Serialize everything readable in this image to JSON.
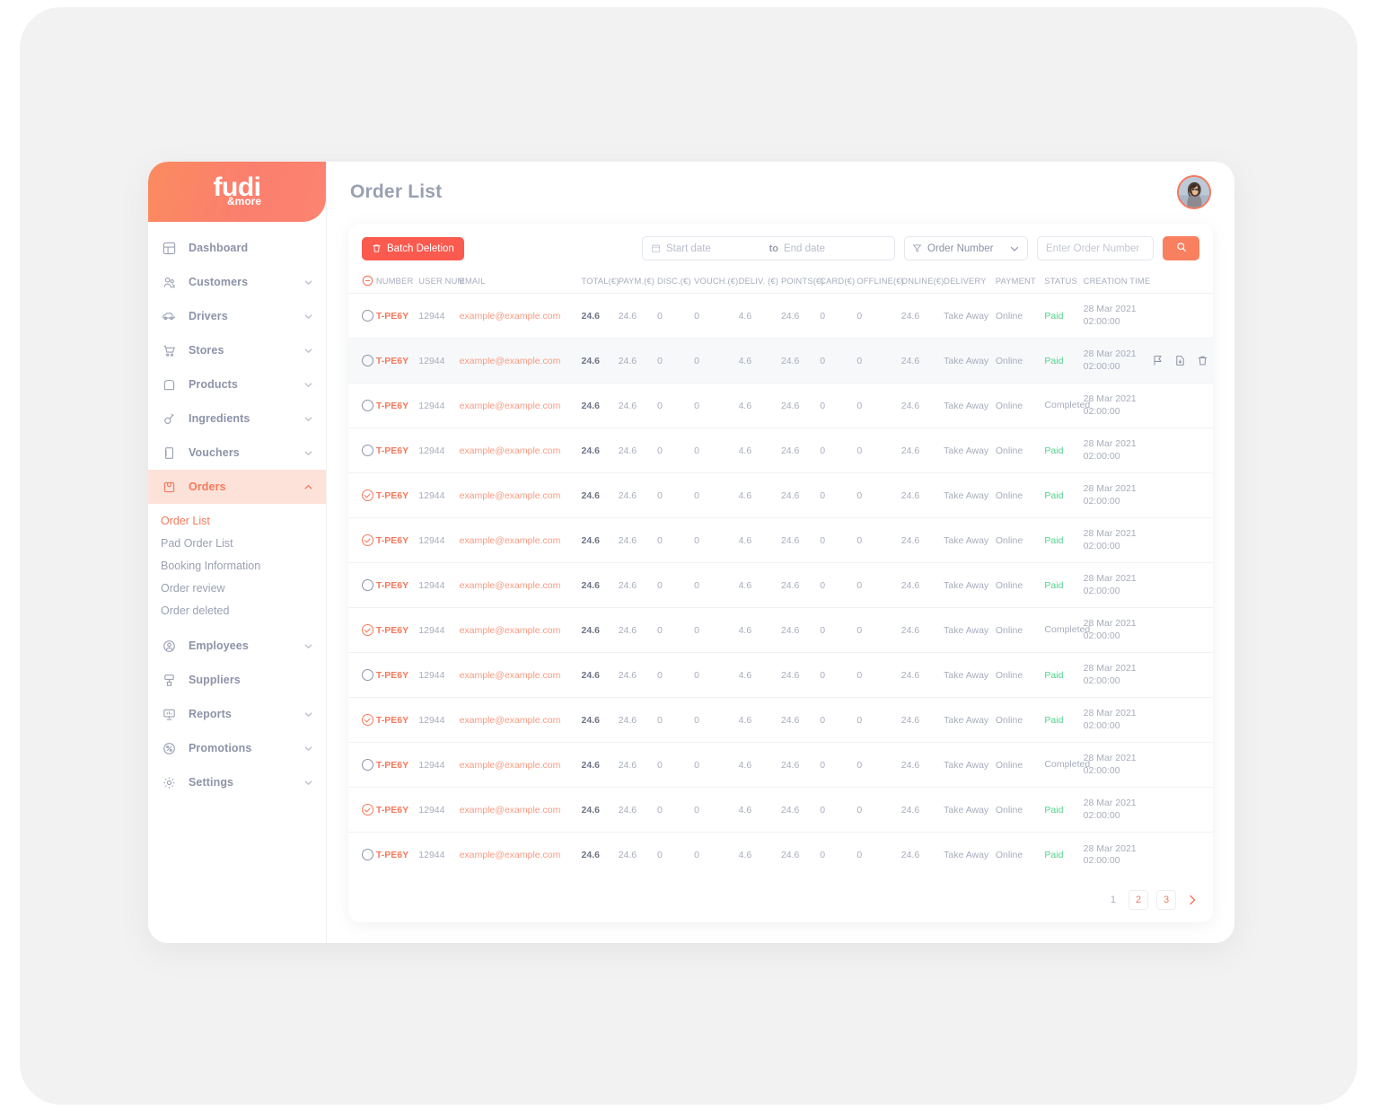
{
  "brand": {
    "line1": "fudi",
    "line2": "&more"
  },
  "header": {
    "title": "Order List"
  },
  "sidebar": {
    "items": [
      {
        "label": "Dashboard",
        "icon": "dashboard-icon",
        "expandable": false
      },
      {
        "label": "Customers",
        "icon": "customers-icon",
        "expandable": true
      },
      {
        "label": "Drivers",
        "icon": "drivers-icon",
        "expandable": true
      },
      {
        "label": "Stores",
        "icon": "stores-icon",
        "expandable": true
      },
      {
        "label": "Products",
        "icon": "products-icon",
        "expandable": true
      },
      {
        "label": "Ingredients",
        "icon": "ingredients-icon",
        "expandable": true
      },
      {
        "label": "Vouchers",
        "icon": "vouchers-icon",
        "expandable": true
      },
      {
        "label": "Orders",
        "icon": "orders-icon",
        "expandable": true,
        "active": true
      },
      {
        "label": "Employees",
        "icon": "employees-icon",
        "expandable": true
      },
      {
        "label": "Suppliers",
        "icon": "suppliers-icon",
        "expandable": false
      },
      {
        "label": "Reports",
        "icon": "reports-icon",
        "expandable": true
      },
      {
        "label": "Promotions",
        "icon": "promotions-icon",
        "expandable": true
      },
      {
        "label": "Settings",
        "icon": "settings-icon",
        "expandable": true
      }
    ],
    "submenu": [
      {
        "label": "Order List",
        "active": true
      },
      {
        "label": "Pad Order List",
        "active": false
      },
      {
        "label": "Booking Information",
        "active": false
      },
      {
        "label": "Order review",
        "active": false
      },
      {
        "label": "Order deleted",
        "active": false
      }
    ]
  },
  "toolbar": {
    "batch_delete_label": "Batch Deletion",
    "start_date_placeholder": "Start date",
    "date_separator": "to",
    "end_date_placeholder": "End date",
    "filter_selected": "Order Number",
    "search_placeholder": "Enter Order Number",
    "search_value": ""
  },
  "table": {
    "columns": [
      "NUMBER",
      "USER NUM",
      "EMAIL",
      "TOTAL(€)",
      "PAYM.(€)",
      "DISC.(€)",
      "VOUCH.(€)",
      "DELIV. (€)",
      "POINTS(€)",
      "CARD(€)",
      "OFFLINE(€)",
      "ONLINE(€)",
      "DELIVERY",
      "PAYMENT",
      "STATUS",
      "CREATION TIME"
    ],
    "rows": [
      {
        "selected": false,
        "hovered": false,
        "number": "T-PE6Y",
        "user_num": "12944",
        "email": "example@example.com",
        "total": "24.6",
        "paym": "24.6",
        "disc": "0",
        "vouch": "0",
        "deliv": "4.6",
        "points": "24.6",
        "card": "0",
        "offline": "0",
        "online": "24.6",
        "delivery": "Take Away",
        "payment": "Online",
        "status": "Paid",
        "time": "28 Mar 2021 02:00:00"
      },
      {
        "selected": false,
        "hovered": true,
        "number": "T-PE6Y",
        "user_num": "12944",
        "email": "example@example.com",
        "total": "24.6",
        "paym": "24.6",
        "disc": "0",
        "vouch": "0",
        "deliv": "4.6",
        "points": "24.6",
        "card": "0",
        "offline": "0",
        "online": "24.6",
        "delivery": "Take Away",
        "payment": "Online",
        "status": "Paid",
        "time": "28 Mar 2021 02:00:00"
      },
      {
        "selected": false,
        "hovered": false,
        "number": "T-PE6Y",
        "user_num": "12944",
        "email": "example@example.com",
        "total": "24.6",
        "paym": "24.6",
        "disc": "0",
        "vouch": "0",
        "deliv": "4.6",
        "points": "24.6",
        "card": "0",
        "offline": "0",
        "online": "24.6",
        "delivery": "Take Away",
        "payment": "Online",
        "status": "Completed",
        "time": "28 Mar 2021 02:00:00"
      },
      {
        "selected": false,
        "hovered": false,
        "number": "T-PE6Y",
        "user_num": "12944",
        "email": "example@example.com",
        "total": "24.6",
        "paym": "24.6",
        "disc": "0",
        "vouch": "0",
        "deliv": "4.6",
        "points": "24.6",
        "card": "0",
        "offline": "0",
        "online": "24.6",
        "delivery": "Take Away",
        "payment": "Online",
        "status": "Paid",
        "time": "28 Mar 2021 02:00:00"
      },
      {
        "selected": true,
        "hovered": false,
        "number": "T-PE6Y",
        "user_num": "12944",
        "email": "example@example.com",
        "total": "24.6",
        "paym": "24.6",
        "disc": "0",
        "vouch": "0",
        "deliv": "4.6",
        "points": "24.6",
        "card": "0",
        "offline": "0",
        "online": "24.6",
        "delivery": "Take Away",
        "payment": "Online",
        "status": "Paid",
        "time": "28 Mar 2021 02:00:00"
      },
      {
        "selected": true,
        "hovered": false,
        "number": "T-PE6Y",
        "user_num": "12944",
        "email": "example@example.com",
        "total": "24.6",
        "paym": "24.6",
        "disc": "0",
        "vouch": "0",
        "deliv": "4.6",
        "points": "24.6",
        "card": "0",
        "offline": "0",
        "online": "24.6",
        "delivery": "Take Away",
        "payment": "Online",
        "status": "Paid",
        "time": "28 Mar 2021 02:00:00"
      },
      {
        "selected": false,
        "hovered": false,
        "number": "T-PE6Y",
        "user_num": "12944",
        "email": "example@example.com",
        "total": "24.6",
        "paym": "24.6",
        "disc": "0",
        "vouch": "0",
        "deliv": "4.6",
        "points": "24.6",
        "card": "0",
        "offline": "0",
        "online": "24.6",
        "delivery": "Take Away",
        "payment": "Online",
        "status": "Paid",
        "time": "28 Mar 2021 02:00:00"
      },
      {
        "selected": true,
        "hovered": false,
        "number": "T-PE6Y",
        "user_num": "12944",
        "email": "example@example.com",
        "total": "24.6",
        "paym": "24.6",
        "disc": "0",
        "vouch": "0",
        "deliv": "4.6",
        "points": "24.6",
        "card": "0",
        "offline": "0",
        "online": "24.6",
        "delivery": "Take Away",
        "payment": "Online",
        "status": "Completed",
        "time": "28 Mar 2021 02:00:00"
      },
      {
        "selected": false,
        "hovered": false,
        "number": "T-PE6Y",
        "user_num": "12944",
        "email": "example@example.com",
        "total": "24.6",
        "paym": "24.6",
        "disc": "0",
        "vouch": "0",
        "deliv": "4.6",
        "points": "24.6",
        "card": "0",
        "offline": "0",
        "online": "24.6",
        "delivery": "Take Away",
        "payment": "Online",
        "status": "Paid",
        "time": "28 Mar 2021 02:00:00"
      },
      {
        "selected": true,
        "hovered": false,
        "number": "T-PE6Y",
        "user_num": "12944",
        "email": "example@example.com",
        "total": "24.6",
        "paym": "24.6",
        "disc": "0",
        "vouch": "0",
        "deliv": "4.6",
        "points": "24.6",
        "card": "0",
        "offline": "0",
        "online": "24.6",
        "delivery": "Take Away",
        "payment": "Online",
        "status": "Paid",
        "time": "28 Mar 2021 02:00:00"
      },
      {
        "selected": false,
        "hovered": false,
        "number": "T-PE6Y",
        "user_num": "12944",
        "email": "example@example.com",
        "total": "24.6",
        "paym": "24.6",
        "disc": "0",
        "vouch": "0",
        "deliv": "4.6",
        "points": "24.6",
        "card": "0",
        "offline": "0",
        "online": "24.6",
        "delivery": "Take Away",
        "payment": "Online",
        "status": "Completed",
        "time": "28 Mar 2021 02:00:00"
      },
      {
        "selected": true,
        "hovered": false,
        "number": "T-PE6Y",
        "user_num": "12944",
        "email": "example@example.com",
        "total": "24.6",
        "paym": "24.6",
        "disc": "0",
        "vouch": "0",
        "deliv": "4.6",
        "points": "24.6",
        "card": "0",
        "offline": "0",
        "online": "24.6",
        "delivery": "Take Away",
        "payment": "Online",
        "status": "Paid",
        "time": "28 Mar 2021 02:00:00"
      },
      {
        "selected": false,
        "hovered": false,
        "number": "T-PE6Y",
        "user_num": "12944",
        "email": "example@example.com",
        "total": "24.6",
        "paym": "24.6",
        "disc": "0",
        "vouch": "0",
        "deliv": "4.6",
        "points": "24.6",
        "card": "0",
        "offline": "0",
        "online": "24.6",
        "delivery": "Take Away",
        "payment": "Online",
        "status": "Paid",
        "time": "28 Mar 2021 02:00:00"
      }
    ],
    "row_action_icons": [
      "flag-icon",
      "file-download-icon",
      "trash-icon"
    ]
  },
  "pagination": {
    "current": "1",
    "pages": [
      "2",
      "3"
    ],
    "next_icon": "chevron-right-icon"
  },
  "colors": {
    "accent": "#f5795c",
    "danger": "#fb5a4f",
    "paid": "#4fd48a",
    "muted": "#a7adbd",
    "sidebar_active_bg": "#fde2da"
  }
}
